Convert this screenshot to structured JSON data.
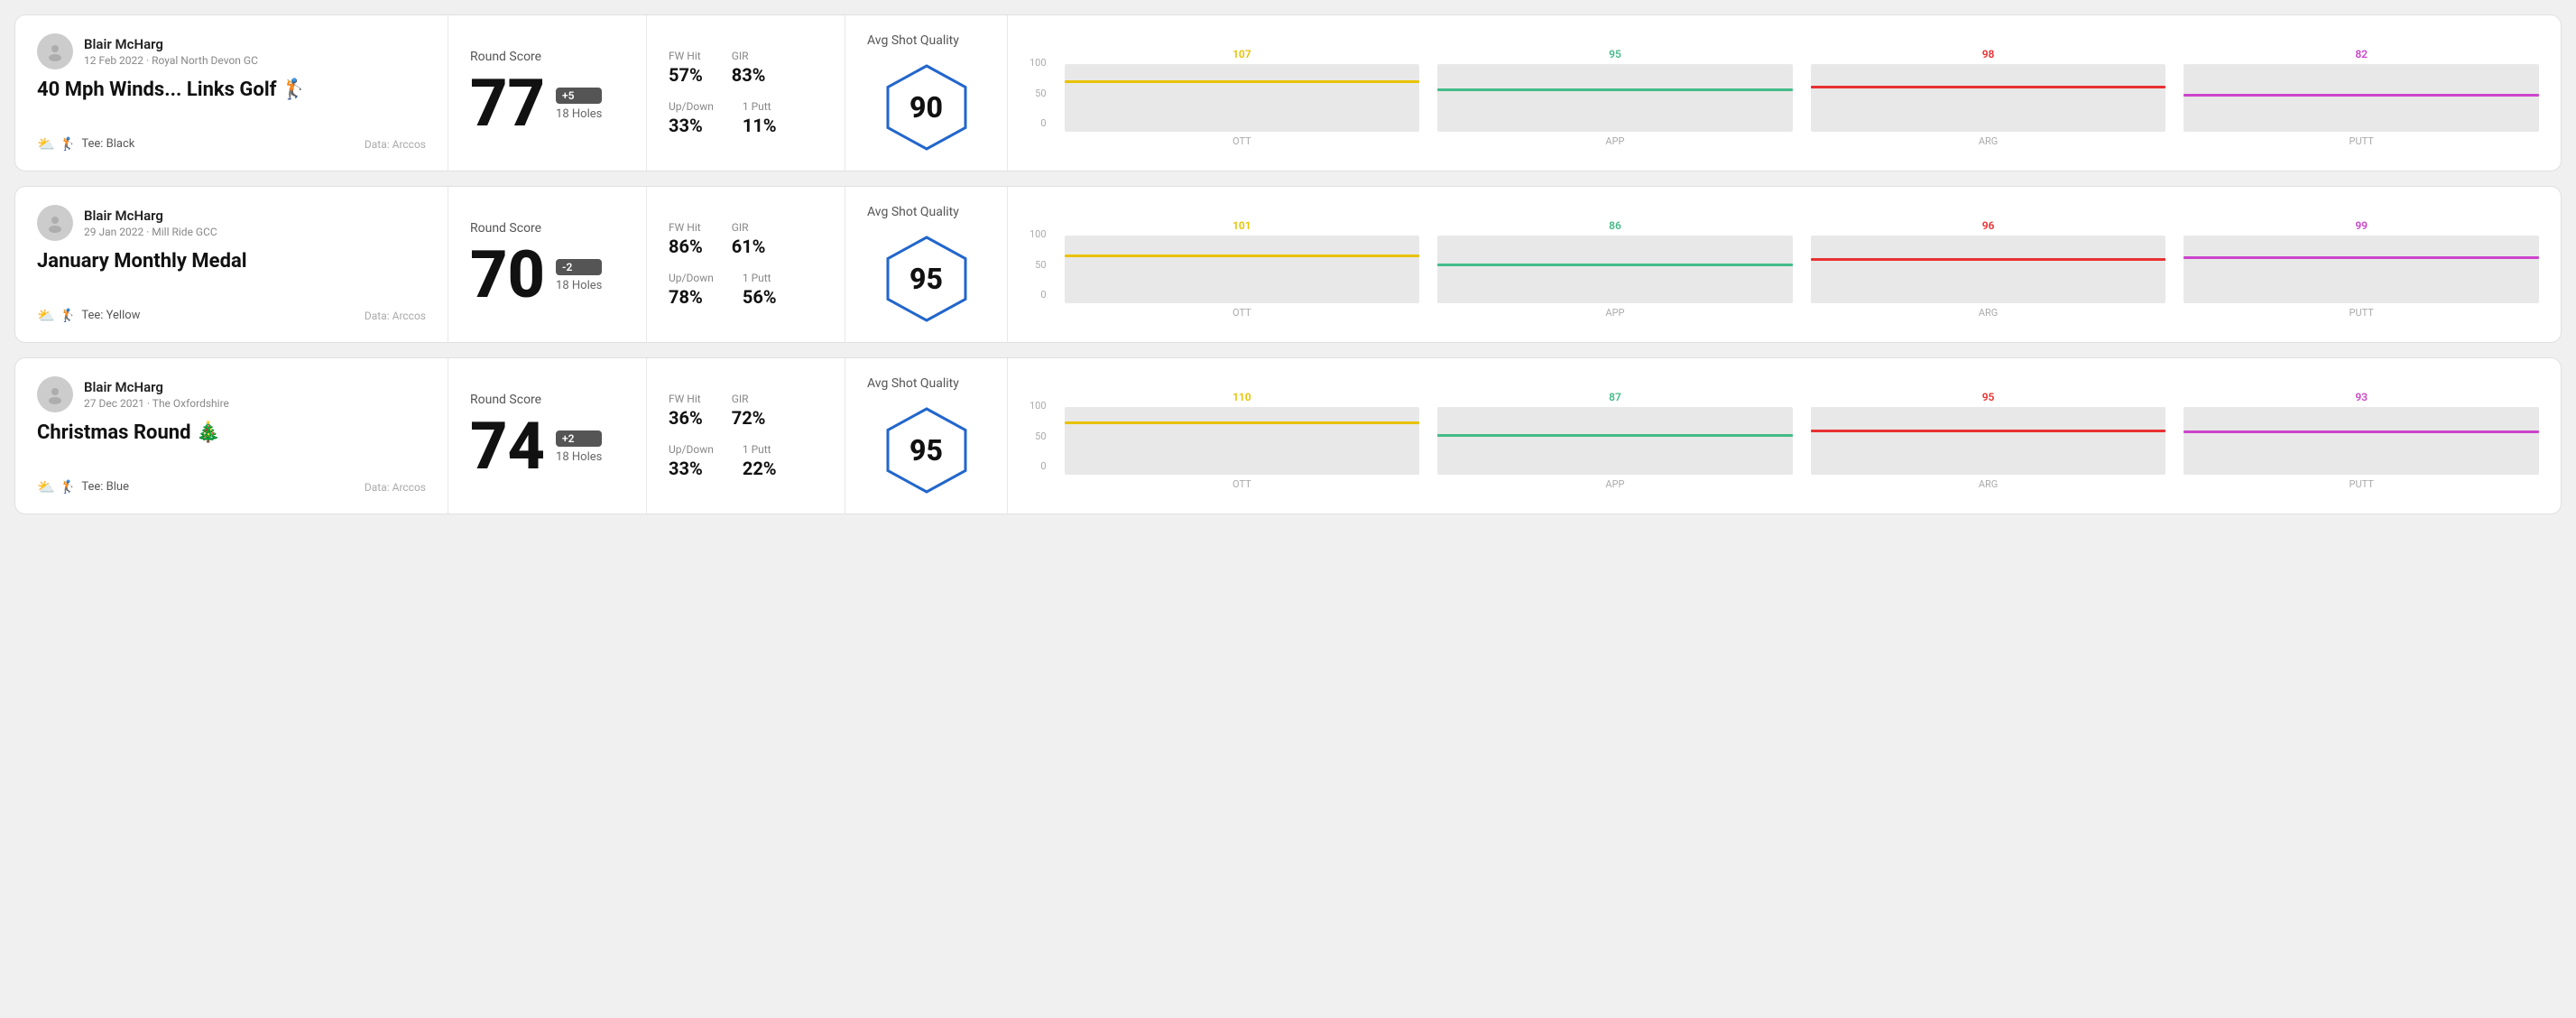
{
  "rounds": [
    {
      "id": "round-1",
      "user": {
        "name": "Blair McHarg",
        "date": "12 Feb 2022 · Royal North Devon GC"
      },
      "title": "40 Mph Winds... Links Golf 🏌️",
      "tee": "Black",
      "data_source": "Data: Arccos",
      "score": {
        "label": "Round Score",
        "number": "77",
        "badge": "+5",
        "holes": "18 Holes"
      },
      "stats": {
        "fw_hit_label": "FW Hit",
        "fw_hit_value": "57%",
        "gir_label": "GIR",
        "gir_value": "83%",
        "updown_label": "Up/Down",
        "updown_value": "33%",
        "one_putt_label": "1 Putt",
        "one_putt_value": "11%"
      },
      "quality": {
        "label": "Avg Shot Quality",
        "score": "90"
      },
      "chart": {
        "y_labels": [
          "100",
          "50",
          "0"
        ],
        "columns": [
          {
            "label": "OTT",
            "value": 107,
            "value_label": "107",
            "color": "#e8c200",
            "bar_pct": 72
          },
          {
            "label": "APP",
            "value": 95,
            "value_label": "95",
            "color": "#44bb88",
            "bar_pct": 60
          },
          {
            "label": "ARG",
            "value": 98,
            "value_label": "98",
            "color": "#e83030",
            "bar_pct": 64
          },
          {
            "label": "PUTT",
            "value": 82,
            "value_label": "82",
            "color": "#cc44cc",
            "bar_pct": 52
          }
        ]
      }
    },
    {
      "id": "round-2",
      "user": {
        "name": "Blair McHarg",
        "date": "29 Jan 2022 · Mill Ride GCC"
      },
      "title": "January Monthly Medal",
      "tee": "Yellow",
      "data_source": "Data: Arccos",
      "score": {
        "label": "Round Score",
        "number": "70",
        "badge": "-2",
        "holes": "18 Holes"
      },
      "stats": {
        "fw_hit_label": "FW Hit",
        "fw_hit_value": "86%",
        "gir_label": "GIR",
        "gir_value": "61%",
        "updown_label": "Up/Down",
        "updown_value": "78%",
        "one_putt_label": "1 Putt",
        "one_putt_value": "56%"
      },
      "quality": {
        "label": "Avg Shot Quality",
        "score": "95"
      },
      "chart": {
        "y_labels": [
          "100",
          "50",
          "0"
        ],
        "columns": [
          {
            "label": "OTT",
            "value": 101,
            "value_label": "101",
            "color": "#e8c200",
            "bar_pct": 68
          },
          {
            "label": "APP",
            "value": 86,
            "value_label": "86",
            "color": "#44bb88",
            "bar_pct": 55
          },
          {
            "label": "ARG",
            "value": 96,
            "value_label": "96",
            "color": "#e83030",
            "bar_pct": 63
          },
          {
            "label": "PUTT",
            "value": 99,
            "value_label": "99",
            "color": "#cc44cc",
            "bar_pct": 65
          }
        ]
      }
    },
    {
      "id": "round-3",
      "user": {
        "name": "Blair McHarg",
        "date": "27 Dec 2021 · The Oxfordshire"
      },
      "title": "Christmas Round 🎄",
      "tee": "Blue",
      "data_source": "Data: Arccos",
      "score": {
        "label": "Round Score",
        "number": "74",
        "badge": "+2",
        "holes": "18 Holes"
      },
      "stats": {
        "fw_hit_label": "FW Hit",
        "fw_hit_value": "36%",
        "gir_label": "GIR",
        "gir_value": "72%",
        "updown_label": "Up/Down",
        "updown_value": "33%",
        "one_putt_label": "1 Putt",
        "one_putt_value": "22%"
      },
      "quality": {
        "label": "Avg Shot Quality",
        "score": "95"
      },
      "chart": {
        "y_labels": [
          "100",
          "50",
          "0"
        ],
        "columns": [
          {
            "label": "OTT",
            "value": 110,
            "value_label": "110",
            "color": "#e8c200",
            "bar_pct": 75
          },
          {
            "label": "APP",
            "value": 87,
            "value_label": "87",
            "color": "#44bb88",
            "bar_pct": 56
          },
          {
            "label": "ARG",
            "value": 95,
            "value_label": "95",
            "color": "#e83030",
            "bar_pct": 62
          },
          {
            "label": "PUTT",
            "value": 93,
            "value_label": "93",
            "color": "#cc44cc",
            "bar_pct": 61
          }
        ]
      }
    }
  ]
}
